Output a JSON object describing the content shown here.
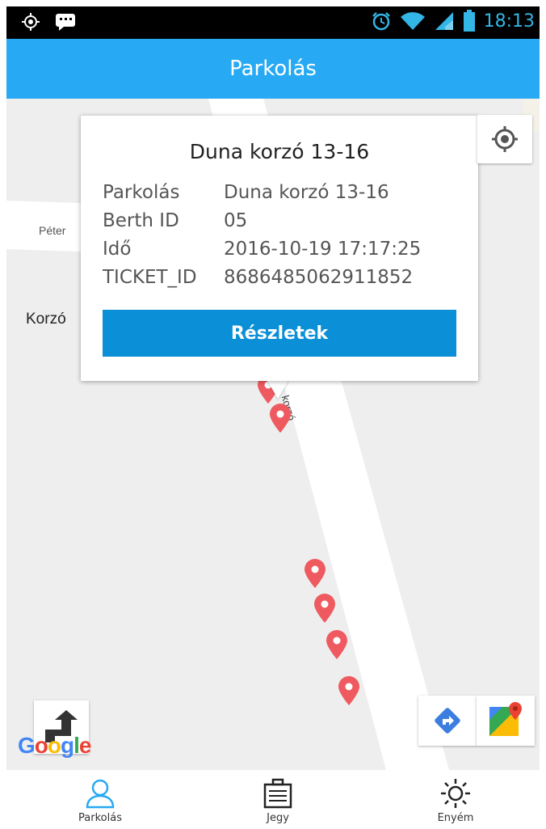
{
  "status_bar": {
    "time": "18:13",
    "icons": [
      "location-icon",
      "message-icon",
      "alarm-icon",
      "wifi-icon",
      "signal-icon",
      "battery-icon"
    ]
  },
  "app_bar": {
    "title": "Parkolás"
  },
  "map": {
    "street_labels": [
      "Péter",
      "Korzó",
      "korzó"
    ],
    "google_logo": "Google"
  },
  "popup": {
    "title": "Duna korzó 13-16",
    "rows": [
      {
        "key": "Parkolás",
        "value": "Duna korzó 13-16"
      },
      {
        "key": "Berth ID",
        "value": "05"
      },
      {
        "key": "Idő",
        "value": "2016-10-19 17:17:25"
      },
      {
        "key": "TICKET_ID",
        "value": "8686485062911852"
      }
    ],
    "button_label": "Részletek"
  },
  "bottom_nav": {
    "items": [
      {
        "label": "Parkolás",
        "icon": "person-icon",
        "active": true
      },
      {
        "label": "Jegy",
        "icon": "ticket-icon",
        "active": false
      },
      {
        "label": "Enyém",
        "icon": "sun-icon",
        "active": false
      }
    ]
  },
  "colors": {
    "app_bar": "#27aaf3",
    "status_text": "#33b5e5",
    "button": "#0b8fd6",
    "pin": "#ee5a5f",
    "active_nav": "#27aaf3"
  }
}
